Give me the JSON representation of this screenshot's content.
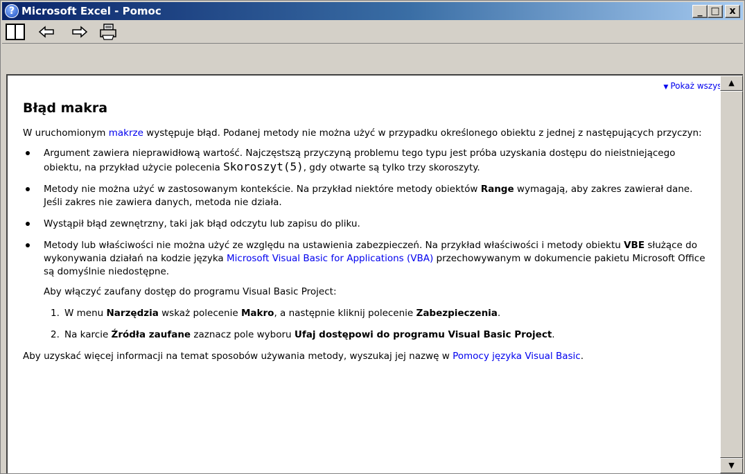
{
  "window": {
    "title": "Microsoft Excel - Pomoc",
    "icon": "help-icon",
    "buttons": {
      "minimize": "_",
      "maximize": "□",
      "close": "x"
    }
  },
  "toolbar": {
    "buttons": [
      {
        "name": "show-pane-icon",
        "interactable": true
      },
      {
        "name": "back-arrow-icon",
        "interactable": true
      },
      {
        "name": "forward-arrow-icon",
        "interactable": true
      },
      {
        "name": "print-icon",
        "interactable": true
      }
    ]
  },
  "content": {
    "show_all": "Pokaż wszystko",
    "heading": "Błąd makra",
    "intro": {
      "before": "W uruchomionym ",
      "link": "makrze",
      "after": " występuje błąd. Podanej metody nie można użyć w przypadku określonego obiektu z jednej z następujących przyczyn:"
    },
    "bullets": {
      "b1": {
        "before": "Argument zawiera nieprawidłową wartość. Najczęstszą przyczyną problemu tego typu jest próba uzyskania dostępu do nieistniejącego obiektu, na przykład użycie polecenia ",
        "code": "Skoroszyt(5)",
        "after": ", gdy otwarte są tylko trzy skoroszyty."
      },
      "b2": {
        "before": "Metody nie można użyć w zastosowanym kontekście. Na przykład niektóre metody obiektów ",
        "bold": "Range",
        "after": " wymagają, aby zakres zawierał dane. Jeśli zakres nie zawiera danych, metoda nie działa."
      },
      "b3": "Wystąpił błąd zewnętrzny, taki jak błąd odczytu lub zapisu do pliku.",
      "b4": {
        "before": "Metody lub właściwości nie można użyć ze względu na ustawienia zabezpieczeń. Na przykład właściwości i metody obiektu ",
        "bold": "VBE",
        "middle": " służące do wykonywania działań na kodzie języka ",
        "link": "Microsoft Visual Basic for Applications (VBA)",
        "after": " przechowywanym w dokumencie pakietu Microsoft Office są domyślnie niedostępne."
      }
    },
    "enable_text": "Aby włączyć zaufany dostęp do programu Visual Basic Project:",
    "steps": {
      "s1": {
        "num": "1.",
        "t1": "W menu ",
        "b1": "Narzędzia",
        "t2": " wskaż polecenie ",
        "b2": "Makro",
        "t3": ", a następnie kliknij polecenie ",
        "b3": "Zabezpieczenia",
        "t4": "."
      },
      "s2": {
        "num": "2.",
        "t1": "Na karcie ",
        "b1": "Źródła zaufane",
        "t2": " zaznacz pole wyboru ",
        "b2": "Ufaj dostępowi do programu Visual Basic Project",
        "t3": "."
      }
    },
    "footer": {
      "before": "Aby uzyskać więcej informacji na temat sposobów używania metody, wyszukaj jej nazwę w ",
      "link": "Pomocy języka Visual Basic",
      "after": "."
    }
  },
  "colors": {
    "title_start": "#0a246a",
    "title_end": "#a6caf0",
    "link": "#0000ee",
    "chrome": "#d4d0c8"
  }
}
